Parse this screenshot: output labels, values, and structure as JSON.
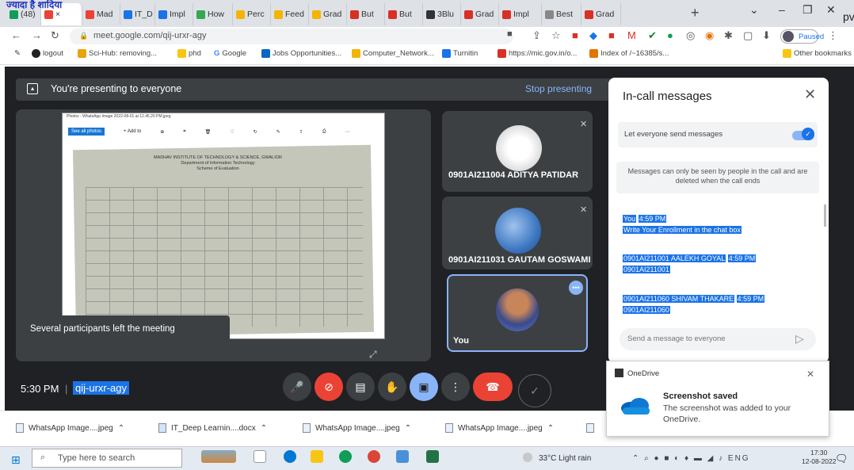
{
  "overlay_text": "ज्यादा है शादिया",
  "edge_text": "pv",
  "browser": {
    "tabs": [
      {
        "label": "(48)",
        "color": "#0f9d58"
      },
      {
        "label": "×",
        "color": "#ea4335"
      },
      {
        "label": "Mad",
        "color": "#ea4335"
      },
      {
        "label": "IT_D",
        "color": "#1a73e8"
      },
      {
        "label": "Impl",
        "color": "#1a73e8"
      },
      {
        "label": "How",
        "color": "#34a853"
      },
      {
        "label": "Perc",
        "color": "#f4b400"
      },
      {
        "label": "Feed",
        "color": "#f4b400"
      },
      {
        "label": "Grad",
        "color": "#f4b400"
      },
      {
        "label": "But",
        "color": "#d93025"
      },
      {
        "label": "But",
        "color": "#d93025"
      },
      {
        "label": "3Blu",
        "color": "#333333"
      },
      {
        "label": "Grad",
        "color": "#d93025"
      },
      {
        "label": "Impl",
        "color": "#d93025"
      },
      {
        "label": "Best",
        "color": "#888888"
      },
      {
        "label": "Grad",
        "color": "#d93025"
      }
    ],
    "new_tab": "+",
    "url": "meet.google.com/qij-urxr-agy",
    "profile_status": "Paused",
    "bookmarks": [
      "logout",
      "Sci-Hub: removing...",
      "phd",
      "Google",
      "Jobs Opportunities...",
      "Computer_Network...",
      "Turnitin",
      "https://mic.gov.in/o...",
      "Index of /~16385/s...",
      "Other bookmarks"
    ]
  },
  "meet": {
    "presenting_text": "You're presenting to everyone",
    "stop_presenting": "Stop presenting",
    "shared_window_title": "Photos - WhatsApp Image 2022-08-01 at 12.45.20 PM.jpeg",
    "shared_toolbar": [
      "See all photos",
      "+ Add to"
    ],
    "doc_heading": "MADHAV INSTITUTE OF TECHNOLOGY & SCIENCE, GWALIOR\nDepartment of Information Technology\nScheme of Evaluation",
    "left_toast": "Several participants left the meeting",
    "participants": [
      {
        "name": "0901AI211004 ADITYA PATIDAR"
      },
      {
        "name": "0901AI211031 GAUTAM GOSWAMI"
      },
      {
        "name": "You"
      }
    ],
    "clock": "5:30 PM",
    "meeting_code": "qij-urxr-agy"
  },
  "chat": {
    "title": "In-call messages",
    "setting_label": "Let everyone send messages",
    "notice": "Messages can only be seen by people in the call and are deleted when the call ends",
    "messages": [
      {
        "sender": "You",
        "time": "4:59 PM",
        "text": "Write Your Enrollment in the chat box"
      },
      {
        "sender": "0901AI211001 AALEKH GOYAL",
        "time": "4:59 PM",
        "text": "0901AI211001"
      },
      {
        "sender": "0901AI211060 SHIVAM THAKARE",
        "time": "4:59 PM",
        "text": "0901AI211060"
      }
    ],
    "input_placeholder": "Send a message to everyone"
  },
  "onedrive": {
    "app": "OneDrive",
    "title": "Screenshot saved",
    "body": "The screenshot was added to your OneDrive."
  },
  "downloads": [
    "WhatsApp Image....jpeg",
    "IT_Deep Learnin....docx",
    "WhatsApp Image....jpeg",
    "WhatsApp Image....jpeg"
  ],
  "taskbar": {
    "search_placeholder": "Type here to search",
    "weather": "33°C  Light rain",
    "language": "ENG",
    "time": "17:30",
    "date": "12-08-2022"
  }
}
